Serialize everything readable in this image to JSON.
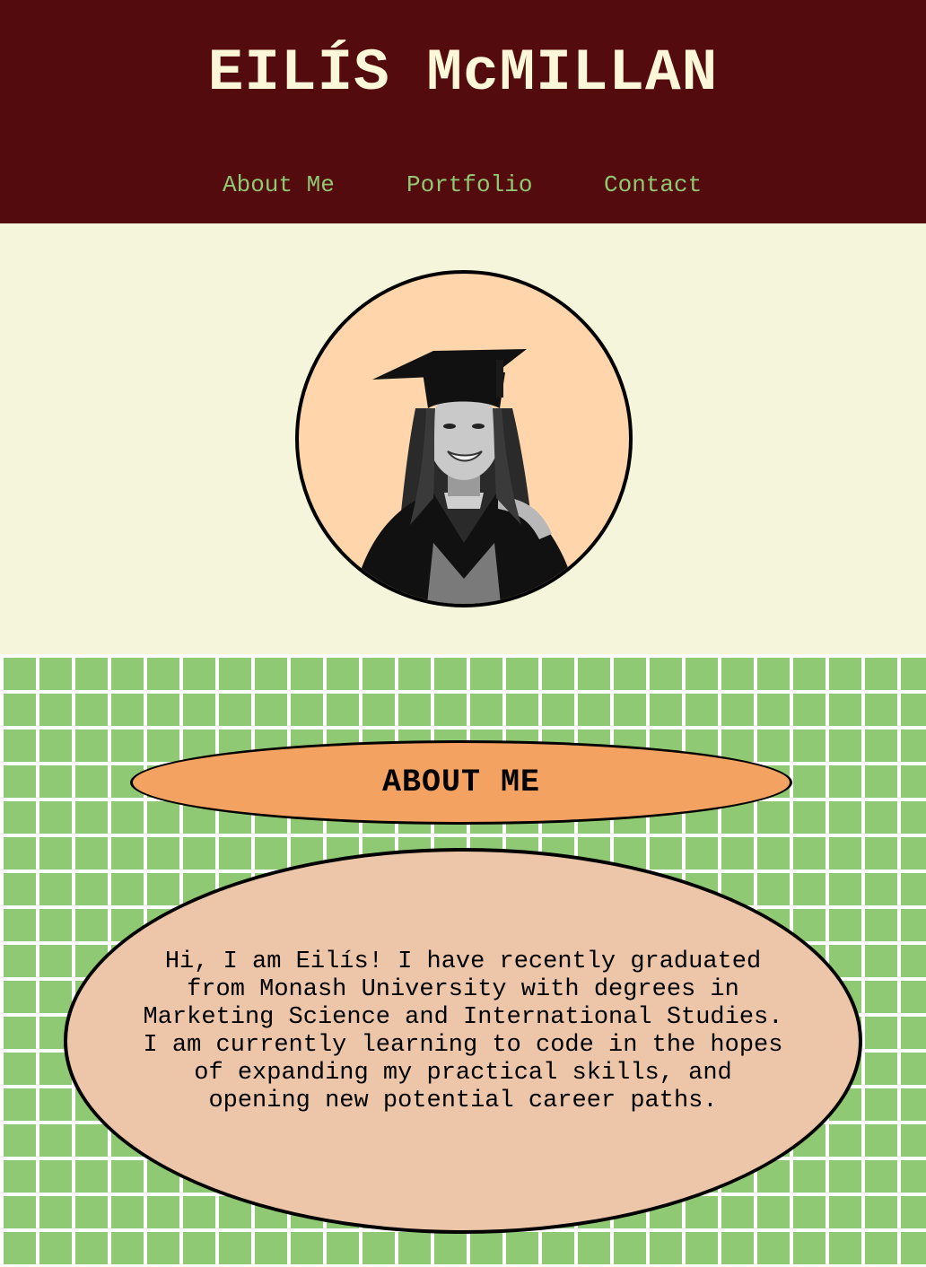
{
  "header": {
    "title": "EILÍS McMILLAN",
    "nav": [
      {
        "label": "About Me"
      },
      {
        "label": "Portfolio"
      },
      {
        "label": "Contact"
      }
    ]
  },
  "hero": {
    "avatar_icon": "graduate-portrait-photo"
  },
  "about": {
    "heading": "ABOUT ME",
    "text": "Hi, I am Eilís! I have recently graduated from Monash University with degrees in Marketing Science and International Studies. I am currently learning to code in the hopes of expanding my practical skills, and opening new potential career paths."
  },
  "colors": {
    "header_bg": "#540b0e",
    "title": "#fcf7d8",
    "nav_link": "#8fc973",
    "page_bg": "#f5f5dc",
    "avatar_bg": "#ffd6ac",
    "grid_bg": "#8fc973",
    "about_pill": "#f4a261",
    "about_card": "#edc6aa"
  }
}
